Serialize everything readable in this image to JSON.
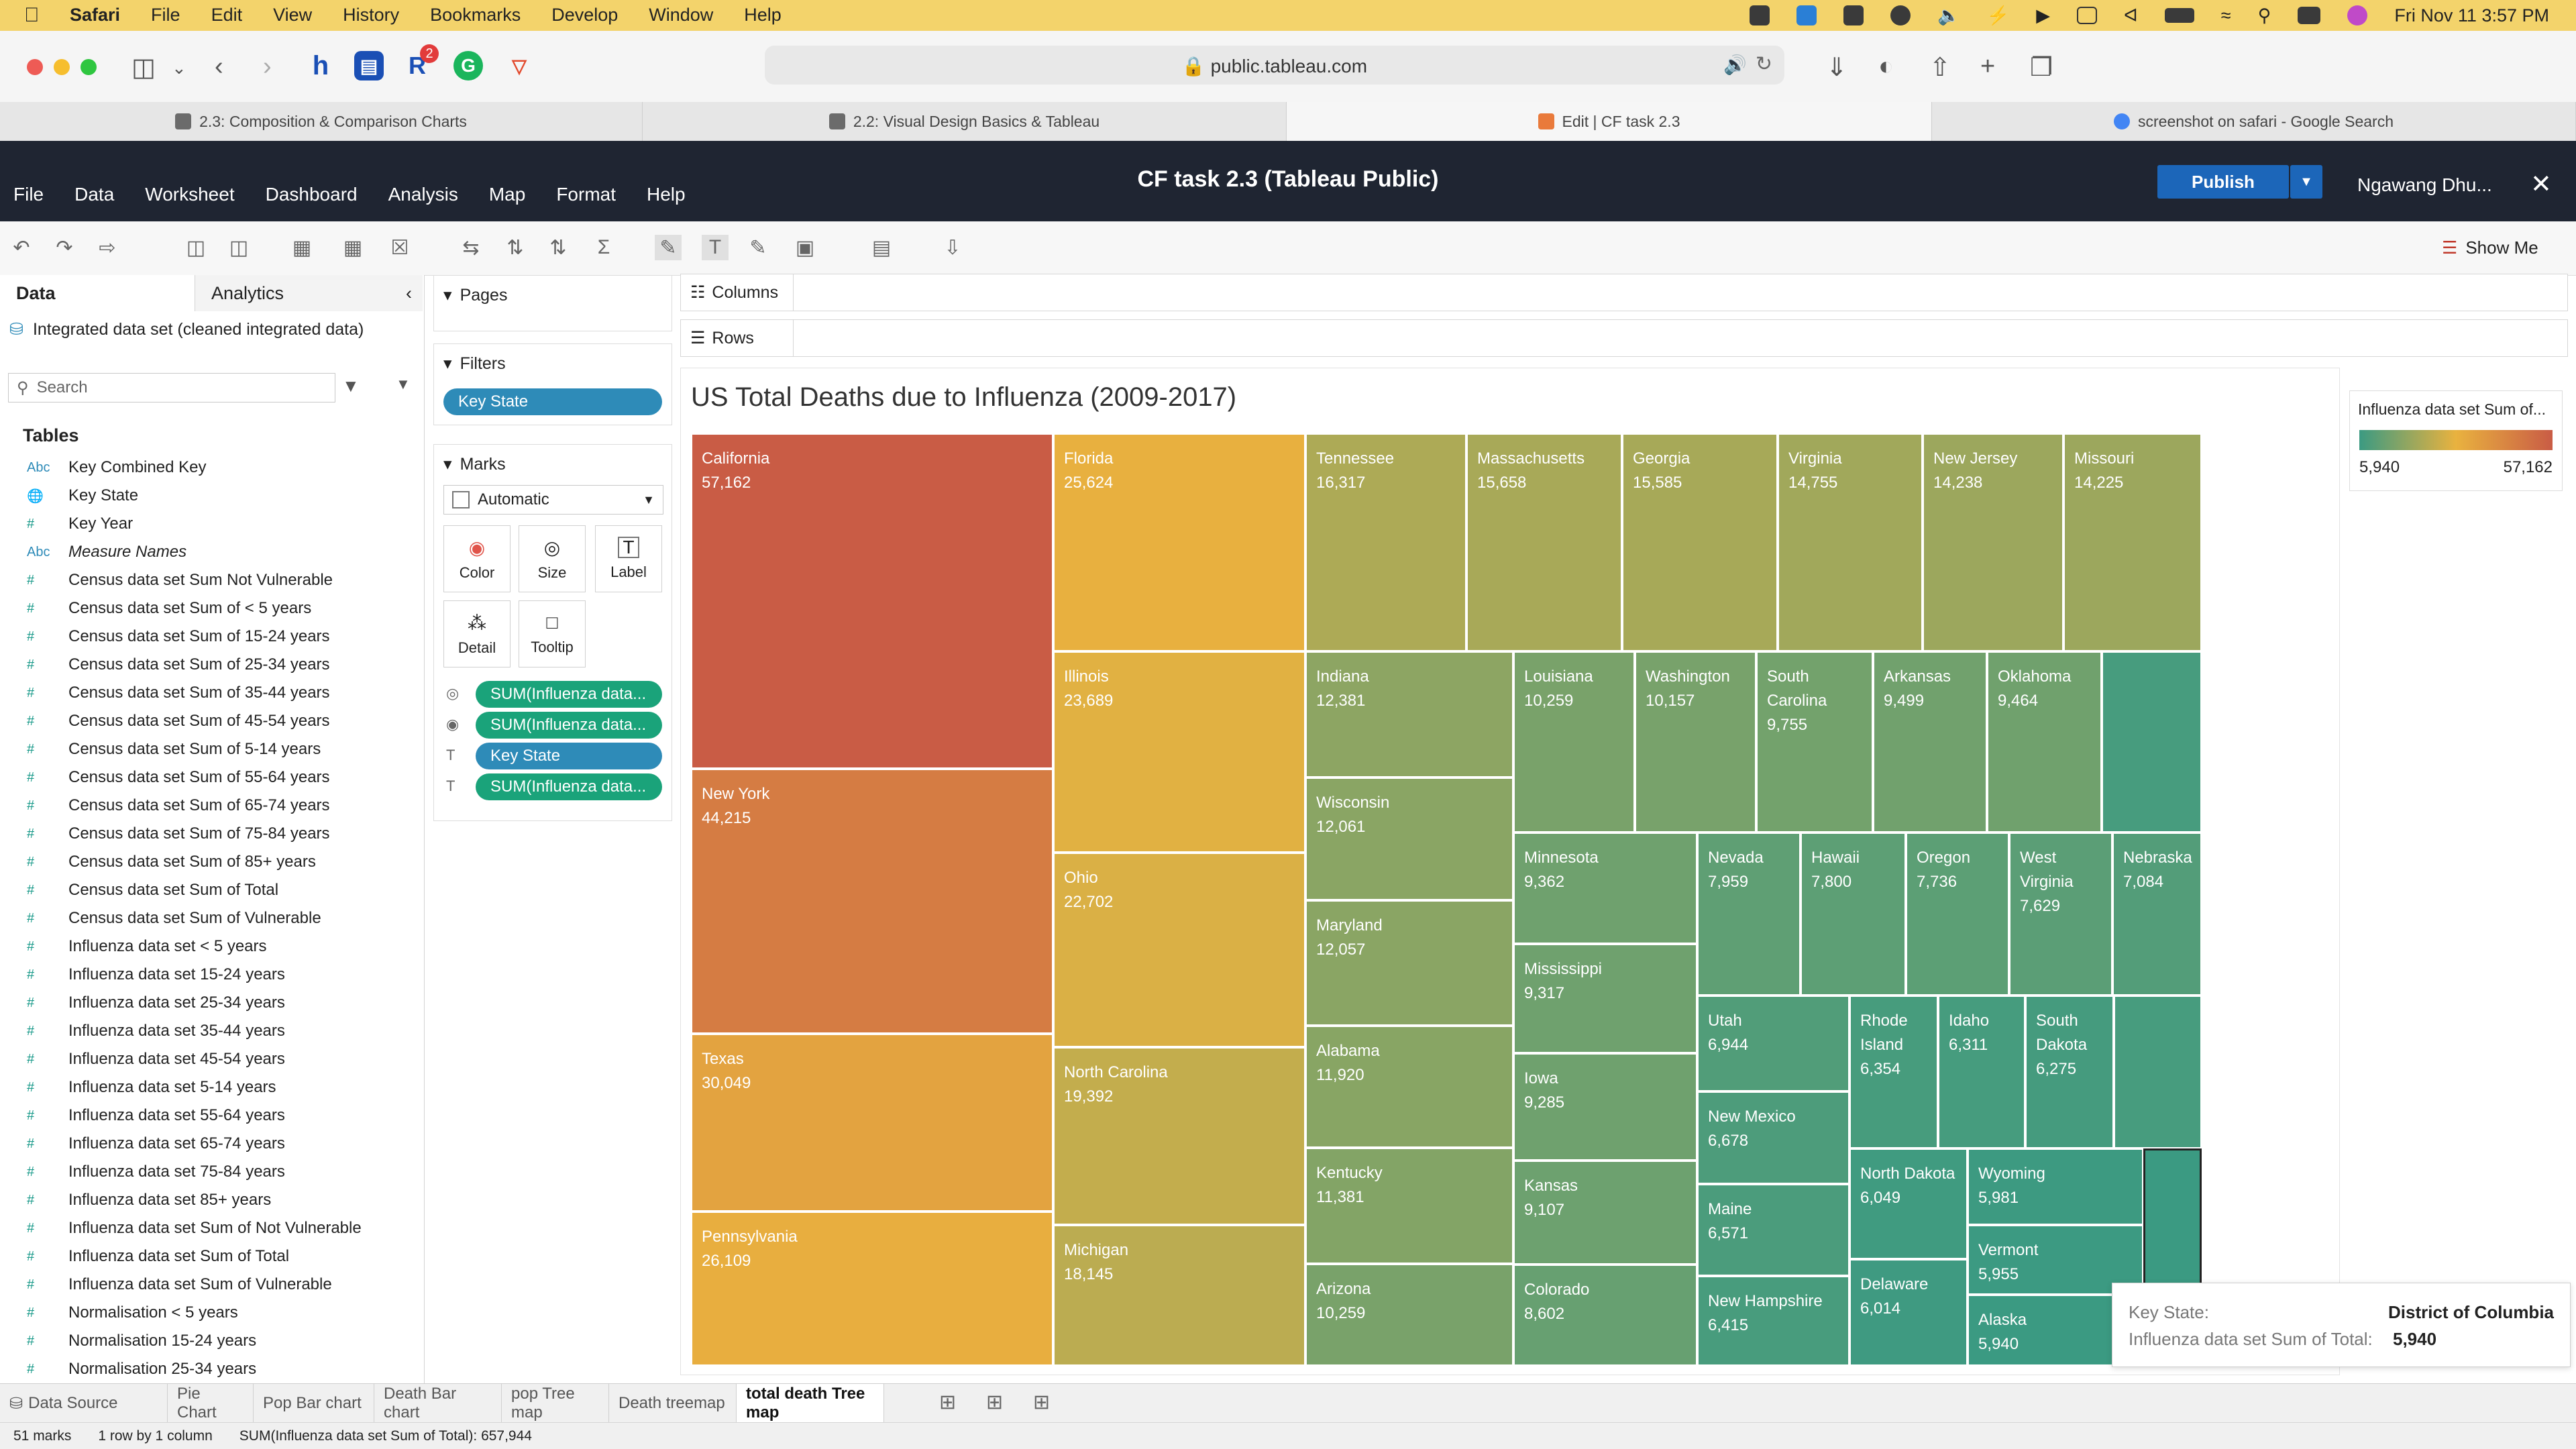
{
  "menubar": {
    "app": "Safari",
    "items": [
      "File",
      "Edit",
      "View",
      "History",
      "Bookmarks",
      "Develop",
      "Window",
      "Help"
    ],
    "clock": "Fri Nov 11  3:57 PM"
  },
  "safari": {
    "url": "public.tableau.com",
    "ext_badge": "2",
    "tabs": [
      {
        "label": "2.3: Composition & Comparison Charts",
        "active": false
      },
      {
        "label": "2.2: Visual Design Basics & Tableau",
        "active": false
      },
      {
        "label": "Edit | CF task 2.3",
        "active": true
      },
      {
        "label": "screenshot on safari - Google Search",
        "active": false
      }
    ]
  },
  "tableau": {
    "menus": [
      "File",
      "Data",
      "Worksheet",
      "Dashboard",
      "Analysis",
      "Map",
      "Format",
      "Help"
    ],
    "title": "CF task 2.3 (Tableau Public)",
    "publish_label": "Publish",
    "user": "Ngawang Dhu...",
    "show_me": "Show Me"
  },
  "data_pane": {
    "tab_data": "Data",
    "tab_analytics": "Analytics",
    "datasource": "Integrated data set (cleaned integrated data)",
    "search_placeholder": "Search",
    "tables_label": "Tables",
    "fields": [
      {
        "type": "Abc",
        "name": "Key Combined Key"
      },
      {
        "type": "globe",
        "name": "Key State"
      },
      {
        "type": "#",
        "name": "Key Year"
      },
      {
        "type": "Abc",
        "name": "Measure Names",
        "italic": true
      },
      {
        "type": "#",
        "name": "Census data set Sum Not Vulnerable"
      },
      {
        "type": "#",
        "name": "Census data set Sum of < 5 years"
      },
      {
        "type": "#",
        "name": "Census data set Sum of 15-24 years"
      },
      {
        "type": "#",
        "name": "Census data set Sum of 25-34 years"
      },
      {
        "type": "#",
        "name": "Census data set Sum of 35-44 years"
      },
      {
        "type": "#",
        "name": "Census data set Sum of 45-54 years"
      },
      {
        "type": "#",
        "name": "Census data set Sum of 5-14 years"
      },
      {
        "type": "#",
        "name": "Census data set Sum of 55-64 years"
      },
      {
        "type": "#",
        "name": "Census data set Sum of 65-74 years"
      },
      {
        "type": "#",
        "name": "Census data set Sum of 75-84 years"
      },
      {
        "type": "#",
        "name": "Census data set Sum of 85+ years"
      },
      {
        "type": "#",
        "name": "Census data set Sum of Total"
      },
      {
        "type": "#",
        "name": "Census data set Sum of Vulnerable"
      },
      {
        "type": "#",
        "name": "Influenza data set < 5 years"
      },
      {
        "type": "#",
        "name": "Influenza data set 15-24 years"
      },
      {
        "type": "#",
        "name": "Influenza data set 25-34 years"
      },
      {
        "type": "#",
        "name": "Influenza data set 35-44 years"
      },
      {
        "type": "#",
        "name": "Influenza data set 45-54 years"
      },
      {
        "type": "#",
        "name": "Influenza data set 5-14 years"
      },
      {
        "type": "#",
        "name": "Influenza data set 55-64 years"
      },
      {
        "type": "#",
        "name": "Influenza data set 65-74 years"
      },
      {
        "type": "#",
        "name": "Influenza data set 75-84 years"
      },
      {
        "type": "#",
        "name": "Influenza data set 85+ years"
      },
      {
        "type": "#",
        "name": "Influenza data set Sum of Not Vulnerable"
      },
      {
        "type": "#",
        "name": "Influenza data set Sum of Total"
      },
      {
        "type": "#",
        "name": "Influenza data set Sum of Vulnerable"
      },
      {
        "type": "#",
        "name": "Normalisation < 5 years"
      },
      {
        "type": "#",
        "name": "Normalisation 15-24 years"
      },
      {
        "type": "#",
        "name": "Normalisation 25-34 years"
      }
    ]
  },
  "cards": {
    "pages": "Pages",
    "filters": "Filters",
    "filter_pill": "Key State",
    "marks": "Marks",
    "mark_type": "Automatic",
    "buttons": [
      "Color",
      "Size",
      "Label",
      "Detail",
      "Tooltip"
    ],
    "mark_pills": [
      {
        "label": "SUM(Influenza data...",
        "color": "#1aa37a"
      },
      {
        "label": "SUM(Influenza data...",
        "color": "#1aa37a"
      },
      {
        "label": "Key State",
        "color": "#2e8bb8"
      },
      {
        "label": "SUM(Influenza data...",
        "color": "#1aa37a"
      }
    ]
  },
  "shelves": {
    "columns": "Columns",
    "rows": "Rows"
  },
  "viz": {
    "title": "US Total Deaths due to Influenza (2009-2017)"
  },
  "legend": {
    "title": "Influenza data set Sum of...",
    "min": "5,940",
    "max": "57,162"
  },
  "tooltip": {
    "k1": "Key State:",
    "v1": "District of Columbia",
    "k2": "Influenza data set Sum of Total:",
    "v2": "5,940"
  },
  "sheet_tabs": [
    "Data Source",
    "Pie Chart",
    "Pop Bar chart",
    "Death Bar chart",
    "pop Tree map",
    "Death treemap",
    "total death Tree map"
  ],
  "status": {
    "marks": "51 marks",
    "rows": "1 row by 1 column",
    "sum": "SUM(Influenza data set Sum of Total): 657,944"
  },
  "chart_data": {
    "type": "treemap",
    "title": "US Total Deaths due to Influenza (2009-2017)",
    "color_range": [
      "#3b9a82",
      "#e9b23f",
      "#c95c45"
    ],
    "value_range": [
      5940,
      57162
    ],
    "total": 657944,
    "mark_count": 51,
    "items": [
      {
        "label": "California",
        "value": 57162,
        "value_text": "57,162"
      },
      {
        "label": "New York",
        "value": 44215,
        "value_text": "44,215"
      },
      {
        "label": "Texas",
        "value": 30049,
        "value_text": "30,049"
      },
      {
        "label": "Pennsylvania",
        "value": 26109,
        "value_text": "26,109"
      },
      {
        "label": "Florida",
        "value": 25624,
        "value_text": "25,624"
      },
      {
        "label": "Illinois",
        "value": 23689,
        "value_text": "23,689"
      },
      {
        "label": "Ohio",
        "value": 22702,
        "value_text": "22,702"
      },
      {
        "label": "North Carolina",
        "value": 19392,
        "value_text": "19,392"
      },
      {
        "label": "Michigan",
        "value": 18145,
        "value_text": "18,145"
      },
      {
        "label": "Tennessee",
        "value": 16317,
        "value_text": "16,317"
      },
      {
        "label": "Massachusetts",
        "value": 15658,
        "value_text": "15,658"
      },
      {
        "label": "Georgia",
        "value": 15585,
        "value_text": "15,585"
      },
      {
        "label": "Virginia",
        "value": 14755,
        "value_text": "14,755"
      },
      {
        "label": "New Jersey",
        "value": 14238,
        "value_text": "14,238"
      },
      {
        "label": "Missouri",
        "value": 14225,
        "value_text": "14,225"
      },
      {
        "label": "Indiana",
        "value": 12381,
        "value_text": "12,381"
      },
      {
        "label": "Wisconsin",
        "value": 12061,
        "value_text": "12,061"
      },
      {
        "label": "Maryland",
        "value": 12057,
        "value_text": "12,057"
      },
      {
        "label": "Alabama",
        "value": 11920,
        "value_text": "11,920"
      },
      {
        "label": "Kentucky",
        "value": 11381,
        "value_text": "11,381"
      },
      {
        "label": "Arizona",
        "value": 10259,
        "value_text": "10,259"
      },
      {
        "label": "Louisiana",
        "value": 10259,
        "value_text": "10,259"
      },
      {
        "label": "Washington",
        "value": 10157,
        "value_text": "10,157"
      },
      {
        "label": "South Carolina",
        "value": 9755,
        "value_text": "9,755"
      },
      {
        "label": "Arkansas",
        "value": 9499,
        "value_text": "9,499"
      },
      {
        "label": "Oklahoma",
        "value": 9464,
        "value_text": "9,464"
      },
      {
        "label": "Minnesota",
        "value": 9362,
        "value_text": "9,362"
      },
      {
        "label": "Mississippi",
        "value": 9317,
        "value_text": "9,317"
      },
      {
        "label": "Iowa",
        "value": 9285,
        "value_text": "9,285"
      },
      {
        "label": "Kansas",
        "value": 9107,
        "value_text": "9,107"
      },
      {
        "label": "Colorado",
        "value": 8602,
        "value_text": "8,602"
      },
      {
        "label": "Nevada",
        "value": 7959,
        "value_text": "7,959"
      },
      {
        "label": "Hawaii",
        "value": 7800,
        "value_text": "7,800"
      },
      {
        "label": "Oregon",
        "value": 7736,
        "value_text": "7,736"
      },
      {
        "label": "West Virginia",
        "value": 7629,
        "value_text": "7,629"
      },
      {
        "label": "Nebraska",
        "value": 7084,
        "value_text": "7,084"
      },
      {
        "label": "Utah",
        "value": 6944,
        "value_text": "6,944"
      },
      {
        "label": "New Mexico",
        "value": 6678,
        "value_text": "6,678"
      },
      {
        "label": "Maine",
        "value": 6571,
        "value_text": "6,571"
      },
      {
        "label": "New Hampshire",
        "value": 6415,
        "value_text": "6,415"
      },
      {
        "label": "Rhode Island",
        "value": 6354,
        "value_text": "6,354"
      },
      {
        "label": "Idaho",
        "value": 6311,
        "value_text": "6,311"
      },
      {
        "label": "South Dakota",
        "value": 6275,
        "value_text": "6,275"
      },
      {
        "label": "North Dakota",
        "value": 6049,
        "value_text": "6,049"
      },
      {
        "label": "Delaware",
        "value": 6014,
        "value_text": "6,014"
      },
      {
        "label": "Wyoming",
        "value": 5981,
        "value_text": "5,981"
      },
      {
        "label": "Vermont",
        "value": 5955,
        "value_text": "5,955"
      },
      {
        "label": "Alaska",
        "value": 5940,
        "value_text": "5,940"
      },
      {
        "label": "",
        "value": null,
        "value_text": ""
      },
      {
        "label": "",
        "value": null,
        "value_text": ""
      },
      {
        "label": "",
        "value": 5940,
        "value_text": "",
        "highlighted": true
      }
    ]
  }
}
